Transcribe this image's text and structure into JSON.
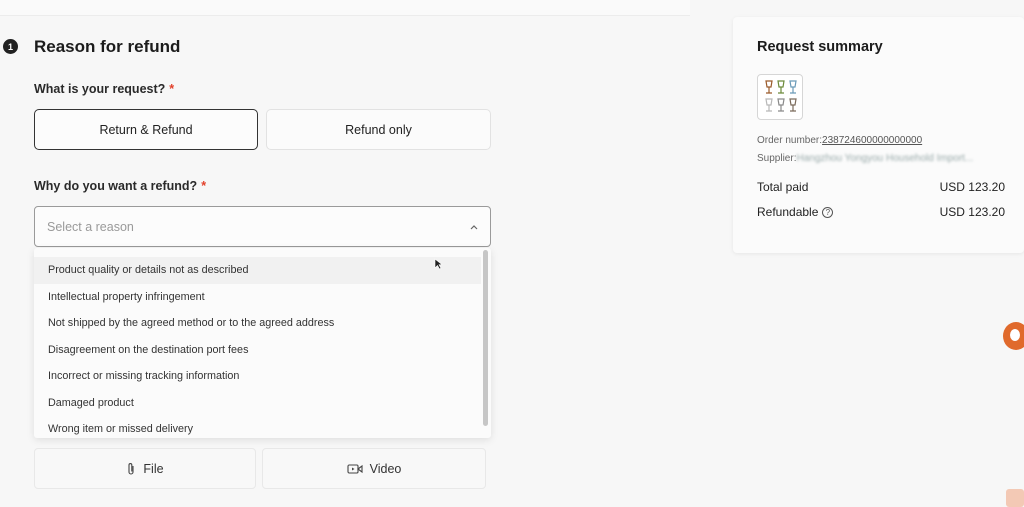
{
  "section": {
    "step": "1",
    "title": "Reason for refund"
  },
  "request": {
    "question": "What is your request?",
    "required_mark": "*",
    "options": [
      "Return & Refund",
      "Refund only"
    ],
    "selected": "Return & Refund"
  },
  "reason": {
    "question": "Why do you want a refund?",
    "required_mark": "*",
    "placeholder": "Select a reason",
    "dropdown_open": true,
    "hovered_item": "Product quality or details not as described",
    "options": [
      "Product quality or details not as described",
      "Intellectual property infringement",
      "Not shipped by the agreed method or to the agreed address",
      "Disagreement on the destination port fees",
      "Incorrect or missing tracking information",
      "Damaged product",
      "Wrong item or missed delivery"
    ]
  },
  "uploads": {
    "file_label": "File",
    "video_label": "Video"
  },
  "summary": {
    "title": "Request summary",
    "order_label": "Order number:",
    "order_value": "238724600000000000",
    "supplier_label": "Supplier:",
    "supplier_value": "Hangzhou Yongyou Household Import...",
    "total_paid_label": "Total paid",
    "total_paid_value": "USD 123.20",
    "refundable_label": "Refundable",
    "refundable_value": "USD 123.20"
  },
  "icons": {
    "step": "number-badge-icon",
    "chevron": "chevron-up-icon",
    "file": "paperclip-icon",
    "video": "video-icon",
    "info": "info-circle-icon",
    "support": "support-agent-icon",
    "cursor": "mouse-cursor-icon"
  },
  "colors": {
    "required": "#e2402a",
    "support": "#e06a2c"
  }
}
